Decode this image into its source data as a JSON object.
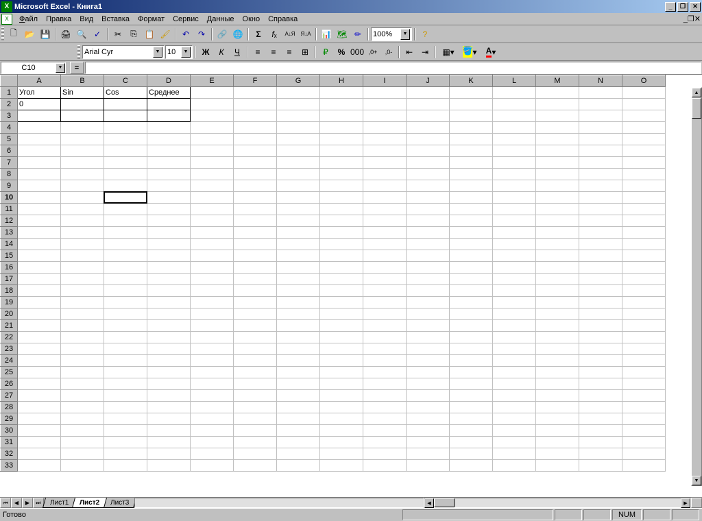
{
  "titlebar": {
    "app_name": "Microsoft Excel",
    "doc_name": "Книга1"
  },
  "menu": {
    "file": "Файл",
    "edit": "Правка",
    "view": "Вид",
    "insert": "Вставка",
    "format": "Формат",
    "tools": "Сервис",
    "data": "Данные",
    "window": "Окно",
    "help": "Справка"
  },
  "toolbar": {
    "font_name": "Arial Cyr",
    "font_size": "10",
    "zoom": "100%",
    "bold": "Ж",
    "italic": "К",
    "underline": "Ч"
  },
  "formula_bar": {
    "name_box": "C10",
    "formula": ""
  },
  "grid": {
    "columns": [
      "A",
      "B",
      "C",
      "D",
      "E",
      "F",
      "G",
      "H",
      "I",
      "J",
      "K",
      "L",
      "M",
      "N",
      "O"
    ],
    "visible_rows": 33,
    "active_row": 10,
    "active_col": "C",
    "headers_row1": {
      "A": "Угол",
      "B": "Sin",
      "C": "Cos",
      "D": "Среднее"
    },
    "row2": {
      "A": "0"
    },
    "bordered_range": {
      "r1": 1,
      "r2": 3,
      "c1": "A",
      "c2": "D"
    }
  },
  "sheets": {
    "tabs": [
      "Лист1",
      "Лист2",
      "Лист3"
    ],
    "active": "Лист2"
  },
  "status": {
    "text": "Готово",
    "num": "NUM"
  }
}
